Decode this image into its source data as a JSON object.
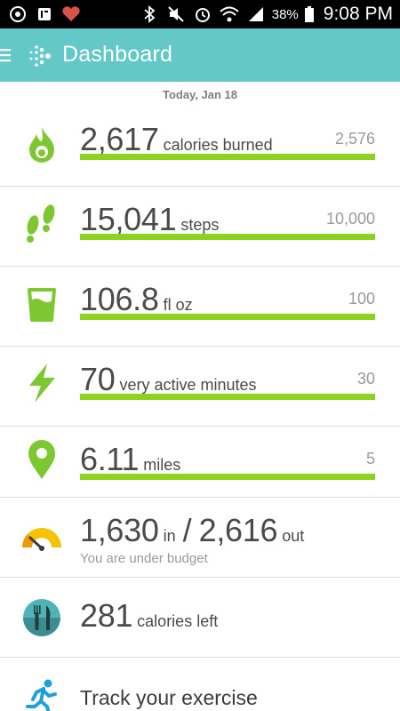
{
  "status_bar": {
    "battery": "38%",
    "time": "9:08 PM",
    "icons": [
      "app-icon",
      "fitbit-notification-icon",
      "heart-notification-icon",
      "bluetooth-icon",
      "mute-icon",
      "alarm-icon",
      "wifi-icon",
      "signal-icon",
      "battery-icon"
    ]
  },
  "app_bar": {
    "title": "Dashboard",
    "menu_icon": "hamburger-menu-icon",
    "logo_icon": "fitbit-logo-icon"
  },
  "date": "Today, Jan 18",
  "colors": {
    "app_bar": "#64c8c8",
    "accent_green": "#8cd21e",
    "icon_green": "#7dc832",
    "gauge_yellow": "#f5c300",
    "food_teal": "#4fb3b8",
    "exercise_blue": "#1ea0dc"
  },
  "rows": {
    "calories": {
      "value": "2,617",
      "unit": "calories burned",
      "goal": "2,576",
      "progress": 1.0,
      "icon": "flame-icon"
    },
    "steps": {
      "value": "15,041",
      "unit": "steps",
      "goal": "10,000",
      "progress": 1.0,
      "icon": "footprints-icon"
    },
    "water": {
      "value": "106.8",
      "unit": "fl oz",
      "goal": "100",
      "progress": 1.0,
      "icon": "water-glass-icon"
    },
    "active": {
      "value": "70",
      "unit": "very active minutes",
      "goal": "30",
      "progress": 1.0,
      "icon": "lightning-icon"
    },
    "distance": {
      "value": "6.11",
      "unit": "miles",
      "goal": "5",
      "progress": 1.0,
      "icon": "location-pin-icon"
    },
    "budget": {
      "in_value": "1,630",
      "in_unit": "in",
      "slash": "/",
      "out_value": "2,616",
      "out_unit": "out",
      "note": "You are under budget",
      "icon": "gauge-icon"
    },
    "food": {
      "value": "281",
      "unit": "calories left",
      "icon": "fork-knife-icon"
    },
    "exercise": {
      "label": "Track your exercise",
      "icon": "running-person-icon"
    }
  }
}
